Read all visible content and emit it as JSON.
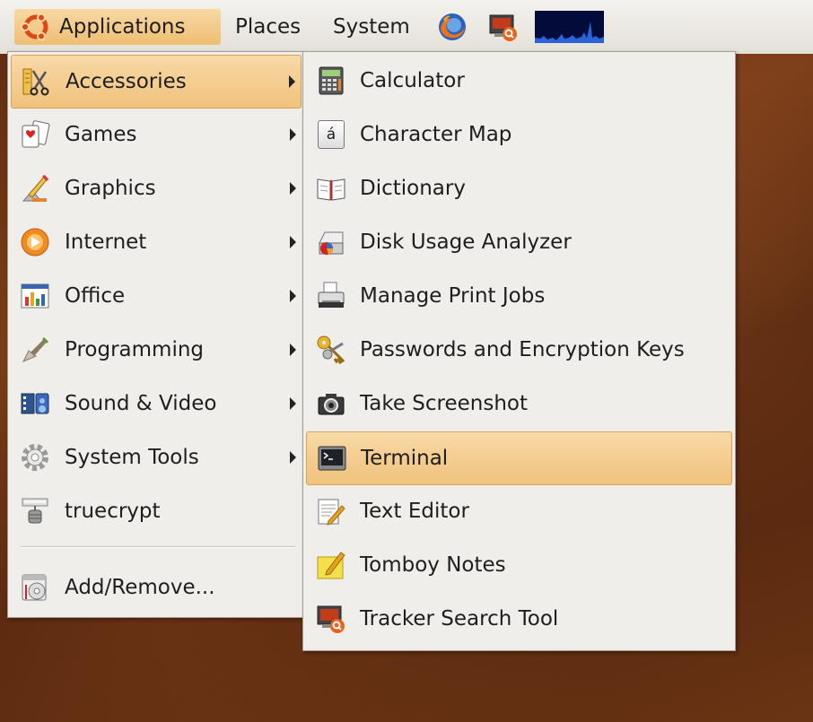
{
  "panel": {
    "menus": [
      "Applications",
      "Places",
      "System"
    ],
    "launchers": [
      {
        "icon": "firefox-icon"
      },
      {
        "icon": "tracker-search-icon"
      },
      {
        "icon": "system-monitor-icon"
      }
    ]
  },
  "applications_menu": {
    "items": [
      {
        "label": "Accessories",
        "icon": "accessories-icon",
        "submenu": true,
        "highlighted": true
      },
      {
        "label": "Games",
        "icon": "games-icon",
        "submenu": true
      },
      {
        "label": "Graphics",
        "icon": "graphics-icon",
        "submenu": true
      },
      {
        "label": "Internet",
        "icon": "internet-icon",
        "submenu": true
      },
      {
        "label": "Office",
        "icon": "office-icon",
        "submenu": true
      },
      {
        "label": "Programming",
        "icon": "programming-icon",
        "submenu": true
      },
      {
        "label": "Sound & Video",
        "icon": "sound-video-icon",
        "submenu": true
      },
      {
        "label": "System Tools",
        "icon": "system-tools-icon",
        "submenu": true
      },
      {
        "label": "truecrypt",
        "icon": "truecrypt-icon",
        "submenu": false
      }
    ],
    "footer_item": {
      "label": "Add/Remove...",
      "icon": "add-remove-icon"
    }
  },
  "accessories_menu": {
    "items": [
      {
        "label": "Calculator",
        "icon": "calculator-icon"
      },
      {
        "label": "Character Map",
        "icon": "character-map-icon"
      },
      {
        "label": "Dictionary",
        "icon": "dictionary-icon"
      },
      {
        "label": "Disk Usage Analyzer",
        "icon": "disk-usage-icon"
      },
      {
        "label": "Manage Print Jobs",
        "icon": "printer-icon"
      },
      {
        "label": "Passwords and Encryption Keys",
        "icon": "keys-icon"
      },
      {
        "label": "Take Screenshot",
        "icon": "camera-icon"
      },
      {
        "label": "Terminal",
        "icon": "terminal-icon",
        "highlighted": true
      },
      {
        "label": "Text Editor",
        "icon": "text-editor-icon"
      },
      {
        "label": "Tomboy Notes",
        "icon": "tomboy-icon"
      },
      {
        "label": "Tracker Search Tool",
        "icon": "tracker-search-icon"
      }
    ],
    "character_map_glyph": "á"
  },
  "colors": {
    "highlight": "#f0c27c",
    "menu_bg": "#f0eeea",
    "ubuntu_orange": "#dd4814",
    "desktop_brown": "#6a3414"
  }
}
